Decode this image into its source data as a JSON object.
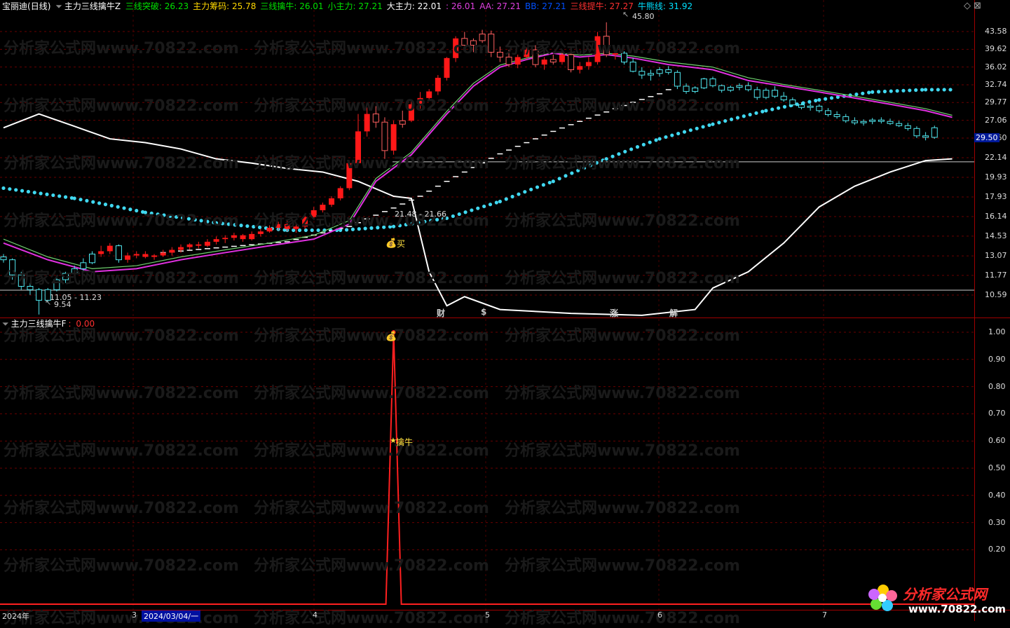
{
  "header": {
    "stock": "宝丽迪",
    "period": "(日线)",
    "indicator": "主力三线擒牛Z",
    "items": [
      {
        "label": "三线突破: ",
        "value": "26.23",
        "color": "#00e000"
      },
      {
        "label": "主力筹码: ",
        "value": "25.78",
        "color": "#ffd800"
      },
      {
        "label": "三线擒牛: ",
        "value": "26.01",
        "color": "#00e000"
      },
      {
        "label": "小主力: ",
        "value": "27.21",
        "color": "#00e000"
      },
      {
        "label": "大主力: ",
        "value": "22.01",
        "color": "#ffffff"
      },
      {
        "label": ": ",
        "value": "26.01",
        "color": "#e040e0"
      },
      {
        "label": "AA: ",
        "value": "27.21",
        "color": "#e040e0"
      },
      {
        "label": "BB: ",
        "value": "27.21",
        "color": "#0050ff"
      },
      {
        "label": "三线提牛: ",
        "value": "27.27",
        "color": "#ff3030"
      },
      {
        "label": "牛熊线: ",
        "value": "31.92",
        "color": "#00e0ff"
      }
    ]
  },
  "lower_header": {
    "indicator": "主力三线擒牛F",
    "value": "0.00"
  },
  "price_axis": [
    "43.58",
    "39.62",
    "36.02",
    "32.74",
    "29.77",
    "27.06",
    "24.60",
    "22.14",
    "19.93",
    "17.93",
    "16.14",
    "14.53",
    "13.07",
    "11.77",
    "10.59"
  ],
  "current_price": "29.50",
  "lower_axis": [
    "1.00",
    "0.90",
    "0.80",
    "0.70",
    "0.60",
    "0.50",
    "0.40",
    "0.30",
    "0.20"
  ],
  "date_axis": [
    "2024年",
    "3",
    "2024/03/04/一",
    "4",
    "5",
    "6",
    "7"
  ],
  "annotations": {
    "high": "45.80",
    "low": "9.54",
    "range_low": "11.05 - 11.23",
    "range_mid": "21.48 - 21.66",
    "buy": "买",
    "signal": "擒牛"
  },
  "events": [
    {
      "label": "财",
      "color": "#60c0ff"
    },
    {
      "label": "$",
      "color": "#ff4040"
    },
    {
      "label": "涨",
      "color": "#ff6060"
    },
    {
      "label": "解",
      "color": "#60e0ff"
    }
  ],
  "watermark": "分析家公式网www.70822.com",
  "logo": {
    "name": "分析家公式网",
    "url": "www.70822.com"
  },
  "chart_data": {
    "type": "candlestick",
    "ylim": [
      9.5,
      46.5
    ],
    "price_ticks": [
      43.58,
      39.62,
      36.02,
      32.74,
      29.77,
      27.06,
      24.6,
      22.14,
      19.93,
      17.93,
      16.14,
      14.53,
      13.07,
      11.77,
      10.59
    ],
    "candles": [
      [
        13.0,
        13.2,
        12.6,
        12.8,
        "c"
      ],
      [
        12.8,
        12.9,
        11.5,
        11.8,
        "c"
      ],
      [
        11.8,
        12.0,
        10.9,
        11.1,
        "c"
      ],
      [
        11.1,
        11.3,
        10.6,
        10.9,
        "c"
      ],
      [
        10.9,
        11.0,
        9.54,
        10.3,
        "c"
      ],
      [
        10.3,
        11.0,
        10.2,
        10.9,
        "c"
      ],
      [
        10.9,
        11.6,
        10.8,
        11.5,
        "c"
      ],
      [
        11.5,
        12.0,
        11.3,
        11.9,
        "c"
      ],
      [
        11.9,
        12.4,
        11.8,
        12.2,
        "c"
      ],
      [
        12.2,
        12.9,
        12.0,
        12.6,
        "c"
      ],
      [
        12.6,
        13.4,
        12.5,
        13.2,
        "c"
      ],
      [
        13.2,
        13.8,
        13.0,
        13.4,
        "r"
      ],
      [
        13.4,
        14.0,
        13.2,
        13.8,
        "r"
      ],
      [
        13.8,
        13.9,
        12.6,
        12.8,
        "c"
      ],
      [
        12.8,
        13.3,
        12.6,
        13.1,
        "r"
      ],
      [
        13.1,
        13.4,
        12.9,
        13.2,
        "r"
      ],
      [
        13.2,
        13.4,
        12.9,
        13.0,
        "r"
      ],
      [
        13.0,
        13.2,
        12.8,
        13.1,
        "r"
      ],
      [
        13.1,
        13.5,
        13.0,
        13.3,
        "r"
      ],
      [
        13.3,
        13.7,
        13.1,
        13.5,
        "r"
      ],
      [
        13.5,
        13.9,
        13.3,
        13.7,
        "r"
      ],
      [
        13.7,
        14.0,
        13.5,
        13.9,
        "r"
      ],
      [
        13.9,
        14.1,
        13.6,
        13.8,
        "r"
      ],
      [
        13.8,
        14.3,
        13.7,
        14.1,
        "r"
      ],
      [
        14.1,
        14.5,
        13.9,
        14.3,
        "r"
      ],
      [
        14.3,
        14.6,
        14.0,
        14.4,
        "r"
      ],
      [
        14.4,
        14.8,
        14.2,
        14.6,
        "r"
      ],
      [
        14.6,
        14.7,
        14.1,
        14.3,
        "r"
      ],
      [
        14.3,
        14.9,
        14.2,
        14.7,
        "r"
      ],
      [
        14.7,
        15.1,
        14.5,
        14.9,
        "r"
      ],
      [
        14.9,
        15.4,
        14.8,
        15.2,
        "r"
      ],
      [
        15.2,
        15.7,
        15.0,
        15.5,
        "r"
      ],
      [
        15.5,
        15.8,
        14.9,
        15.1,
        "r"
      ],
      [
        15.1,
        15.5,
        14.8,
        15.3,
        "r"
      ],
      [
        15.3,
        16.3,
        15.1,
        16.1,
        "r"
      ],
      [
        16.1,
        17.0,
        15.9,
        16.7,
        "r"
      ],
      [
        16.7,
        17.4,
        16.5,
        17.2,
        "r"
      ],
      [
        17.2,
        18.0,
        17.0,
        17.8,
        "r"
      ],
      [
        17.8,
        19.0,
        17.6,
        18.8,
        "r"
      ],
      [
        18.8,
        21.66,
        18.6,
        21.5,
        "r"
      ],
      [
        21.5,
        28.0,
        21.3,
        25.5,
        "r"
      ],
      [
        25.5,
        29.0,
        24.8,
        28.0,
        "r"
      ],
      [
        28.0,
        29.2,
        26.0,
        26.8,
        "h"
      ],
      [
        26.8,
        27.5,
        22.0,
        23.0,
        "h"
      ],
      [
        23.0,
        27.0,
        22.5,
        26.5,
        "r"
      ],
      [
        26.5,
        28.5,
        26.0,
        27.0,
        "h"
      ],
      [
        27.0,
        30.0,
        26.8,
        29.5,
        "r"
      ],
      [
        29.5,
        31.5,
        28.8,
        30.5,
        "r"
      ],
      [
        30.5,
        32.0,
        30.0,
        31.6,
        "r"
      ],
      [
        31.6,
        34.5,
        31.0,
        34.0,
        "r"
      ],
      [
        34.0,
        38.0,
        33.5,
        37.8,
        "r"
      ],
      [
        37.8,
        42.5,
        37.0,
        42.0,
        "r"
      ],
      [
        42.0,
        43.5,
        40.0,
        40.5,
        "h"
      ],
      [
        40.5,
        42.0,
        39.0,
        41.5,
        "h"
      ],
      [
        41.5,
        44.0,
        41.0,
        43.0,
        "h"
      ],
      [
        43.0,
        43.8,
        38.0,
        39.0,
        "h"
      ],
      [
        39.0,
        40.2,
        37.0,
        38.0,
        "h"
      ],
      [
        38.0,
        39.5,
        36.0,
        36.5,
        "h"
      ],
      [
        36.5,
        38.5,
        35.8,
        38.0,
        "r"
      ],
      [
        38.0,
        40.0,
        37.5,
        39.5,
        "r"
      ],
      [
        39.5,
        40.5,
        36.0,
        36.5,
        "h"
      ],
      [
        36.5,
        38.0,
        35.5,
        37.5,
        "r"
      ],
      [
        37.5,
        38.5,
        36.5,
        37.0,
        "h"
      ],
      [
        37.0,
        39.0,
        36.5,
        38.5,
        "r"
      ],
      [
        38.5,
        39.0,
        35.0,
        35.5,
        "h"
      ],
      [
        35.5,
        37.0,
        34.8,
        36.2,
        "r"
      ],
      [
        36.2,
        38.0,
        35.5,
        37.0,
        "r"
      ],
      [
        37.0,
        43.5,
        36.5,
        42.5,
        "r"
      ],
      [
        42.5,
        45.8,
        38.0,
        38.5,
        "h"
      ],
      [
        38.5,
        39.5,
        37.5,
        38.8,
        "r"
      ],
      [
        38.8,
        39.2,
        36.5,
        37.0,
        "c"
      ],
      [
        37.0,
        37.8,
        35.0,
        35.2,
        "c"
      ],
      [
        35.2,
        36.0,
        33.8,
        34.5,
        "c"
      ],
      [
        34.5,
        35.5,
        33.5,
        34.8,
        "c"
      ],
      [
        34.8,
        36.0,
        34.2,
        35.5,
        "c"
      ],
      [
        35.5,
        36.2,
        34.6,
        35.0,
        "c"
      ],
      [
        35.0,
        35.4,
        32.0,
        32.5,
        "c"
      ],
      [
        32.5,
        33.0,
        31.2,
        31.6,
        "c"
      ],
      [
        31.6,
        32.5,
        31.3,
        32.2,
        "c"
      ],
      [
        32.2,
        34.0,
        32.0,
        33.8,
        "c"
      ],
      [
        33.8,
        34.2,
        32.3,
        32.6,
        "c"
      ],
      [
        32.6,
        32.8,
        31.4,
        31.8,
        "c"
      ],
      [
        31.8,
        32.6,
        31.5,
        32.3,
        "c"
      ],
      [
        32.3,
        33.0,
        31.8,
        32.6,
        "c"
      ],
      [
        32.6,
        33.2,
        31.6,
        31.9,
        "c"
      ],
      [
        31.9,
        32.4,
        30.2,
        30.6,
        "c"
      ],
      [
        30.6,
        32.2,
        30.3,
        31.8,
        "c"
      ],
      [
        31.8,
        32.5,
        30.5,
        30.8,
        "c"
      ],
      [
        30.8,
        31.5,
        29.9,
        30.2,
        "c"
      ],
      [
        30.2,
        30.6,
        29.1,
        29.4,
        "c"
      ],
      [
        29.4,
        29.8,
        28.7,
        29.0,
        "c"
      ],
      [
        29.0,
        29.6,
        28.5,
        29.2,
        "c"
      ],
      [
        29.2,
        29.5,
        28.2,
        28.5,
        "c"
      ],
      [
        28.5,
        28.9,
        27.6,
        27.9,
        "c"
      ],
      [
        27.9,
        28.4,
        27.3,
        27.6,
        "c"
      ],
      [
        27.6,
        28.0,
        26.7,
        27.0,
        "c"
      ],
      [
        27.0,
        27.5,
        26.4,
        26.7,
        "c"
      ],
      [
        26.7,
        27.2,
        26.3,
        26.9,
        "c"
      ],
      [
        26.9,
        27.4,
        26.5,
        27.1,
        "c"
      ],
      [
        27.1,
        27.5,
        26.6,
        26.9,
        "c"
      ],
      [
        26.9,
        27.3,
        26.4,
        26.6,
        "c"
      ],
      [
        26.6,
        27.0,
        26.1,
        26.3,
        "c"
      ],
      [
        26.3,
        26.7,
        25.6,
        25.9,
        "c"
      ],
      [
        25.9,
        26.2,
        24.6,
        24.9,
        "c"
      ],
      [
        24.9,
        25.4,
        24.3,
        24.7,
        "c"
      ],
      [
        24.7,
        26.3,
        24.5,
        26.0,
        "c"
      ]
    ],
    "magenta_line": [
      [
        0,
        14.0
      ],
      [
        5,
        12.8
      ],
      [
        10,
        12.0
      ],
      [
        15,
        12.2
      ],
      [
        20,
        12.8
      ],
      [
        25,
        13.3
      ],
      [
        30,
        13.8
      ],
      [
        35,
        14.3
      ],
      [
        39,
        15.5
      ],
      [
        42,
        19.5
      ],
      [
        46,
        22.5
      ],
      [
        50,
        28.0
      ],
      [
        53,
        32.5
      ],
      [
        56,
        36.0
      ],
      [
        59,
        37.5
      ],
      [
        62,
        38.8
      ],
      [
        65,
        38.0
      ],
      [
        68,
        38.5
      ],
      [
        71,
        37.8
      ],
      [
        75,
        36.5
      ],
      [
        80,
        35.5
      ],
      [
        84,
        33.5
      ],
      [
        88,
        32.5
      ],
      [
        92,
        31.5
      ],
      [
        96,
        30.5
      ],
      [
        100,
        29.5
      ],
      [
        104,
        28.5
      ],
      [
        107,
        27.5
      ]
    ],
    "green_line": [
      [
        0,
        14.3
      ],
      [
        5,
        13.0
      ],
      [
        10,
        12.2
      ],
      [
        15,
        12.4
      ],
      [
        20,
        13.0
      ],
      [
        25,
        13.5
      ],
      [
        30,
        14.0
      ],
      [
        35,
        14.6
      ],
      [
        39,
        15.8
      ],
      [
        42,
        19.8
      ],
      [
        46,
        22.8
      ],
      [
        50,
        28.4
      ],
      [
        53,
        33.0
      ],
      [
        56,
        36.4
      ],
      [
        59,
        37.8
      ],
      [
        62,
        38.9
      ],
      [
        65,
        38.4
      ],
      [
        68,
        38.8
      ],
      [
        71,
        38.2
      ],
      [
        75,
        37.0
      ],
      [
        80,
        36.0
      ],
      [
        84,
        34.0
      ],
      [
        88,
        32.8
      ],
      [
        92,
        31.8
      ],
      [
        96,
        30.8
      ],
      [
        100,
        29.8
      ],
      [
        104,
        28.8
      ],
      [
        107,
        27.8
      ]
    ],
    "bull_bear_dots": [
      [
        0,
        18.8
      ],
      [
        8,
        17.8
      ],
      [
        16,
        16.5
      ],
      [
        24,
        15.6
      ],
      [
        32,
        15.0
      ],
      [
        38,
        15.0
      ],
      [
        44,
        15.3
      ],
      [
        50,
        16.0
      ],
      [
        56,
        17.5
      ],
      [
        62,
        19.5
      ],
      [
        68,
        22.0
      ],
      [
        74,
        24.5
      ],
      [
        80,
        26.5
      ],
      [
        86,
        28.5
      ],
      [
        92,
        30.2
      ],
      [
        98,
        31.5
      ],
      [
        104,
        31.9
      ],
      [
        107,
        31.9
      ]
    ],
    "white_steps": [
      [
        18,
        13.3
      ],
      [
        25,
        13.7
      ],
      [
        32,
        14.1
      ],
      [
        39,
        15.3
      ],
      [
        44,
        16.9
      ],
      [
        47,
        18.0
      ],
      [
        50,
        19.5
      ],
      [
        53,
        21.0
      ],
      [
        56,
        22.6
      ],
      [
        59,
        24.0
      ],
      [
        62,
        25.5
      ],
      [
        65,
        26.9
      ],
      [
        68,
        28.3
      ],
      [
        71,
        29.8
      ],
      [
        74,
        31.2
      ],
      [
        76,
        32.6
      ]
    ],
    "white_line": [
      [
        0,
        26.0
      ],
      [
        4,
        28.0
      ],
      [
        8,
        26.2
      ],
      [
        12,
        24.5
      ],
      [
        16,
        24.0
      ],
      [
        20,
        23.2
      ],
      [
        24,
        22.0
      ],
      [
        28,
        21.5
      ],
      [
        32,
        20.9
      ],
      [
        36,
        20.5
      ],
      [
        40,
        19.5
      ],
      [
        44,
        18.0
      ],
      [
        46,
        17.8
      ],
      [
        48,
        12.0
      ],
      [
        50,
        10.0
      ],
      [
        52,
        10.5
      ],
      [
        56,
        9.8
      ],
      [
        64,
        9.6
      ],
      [
        72,
        9.5
      ],
      [
        78,
        9.8
      ],
      [
        80,
        11.0
      ],
      [
        84,
        12.0
      ],
      [
        88,
        14.0
      ],
      [
        92,
        17.0
      ],
      [
        96,
        19.0
      ],
      [
        100,
        20.5
      ],
      [
        104,
        21.8
      ],
      [
        107,
        22.0
      ]
    ],
    "signal_series": {
      "name": "主力三线擒牛F",
      "peak_index": 44,
      "peak_value": 1.0,
      "ylim": [
        0,
        1.05
      ]
    }
  }
}
